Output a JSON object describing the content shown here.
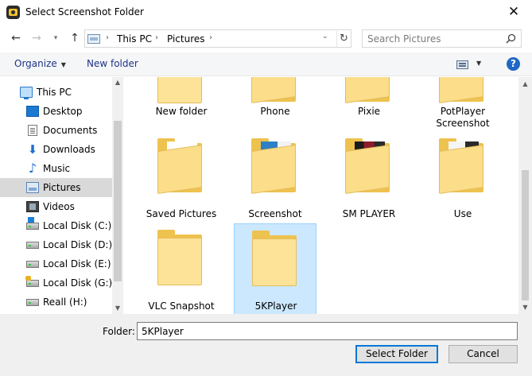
{
  "window": {
    "title": "Select Screenshot Folder",
    "close_glyph": "✕"
  },
  "navigation": {
    "back_glyph": "←",
    "forward_glyph": "→",
    "recent_glyph": "▾",
    "up_glyph": "↑",
    "breadcrumb": [
      "This PC",
      "Pictures"
    ],
    "crumb_separator": "›",
    "dropdown_glyph": "⌄",
    "refresh_glyph": "↻"
  },
  "search": {
    "placeholder": "Search Pictures"
  },
  "toolbar": {
    "organize_label": "Organize",
    "organize_caret": "▼",
    "new_folder_label": "New folder",
    "view_caret": "▼",
    "help_label": "?"
  },
  "sidebar": {
    "items": [
      {
        "label": "This PC",
        "icon": "computer-icon"
      },
      {
        "label": "Desktop",
        "icon": "desktop-folder-icon"
      },
      {
        "label": "Documents",
        "icon": "documents-icon"
      },
      {
        "label": "Downloads",
        "icon": "download-arrow-icon"
      },
      {
        "label": "Music",
        "icon": "music-note-icon"
      },
      {
        "label": "Pictures",
        "icon": "pictures-icon",
        "selected": true
      },
      {
        "label": "Videos",
        "icon": "film-icon"
      },
      {
        "label": "Local Disk (C:)",
        "icon": "system-drive-icon"
      },
      {
        "label": "Local Disk (D:)",
        "icon": "drive-icon"
      },
      {
        "label": "Local Disk (E:)",
        "icon": "drive-icon"
      },
      {
        "label": "Local Disk (G:)",
        "icon": "locked-drive-icon"
      },
      {
        "label": "Reall (H:)",
        "icon": "drive-icon"
      }
    ],
    "scroll_up_glyph": "▲",
    "scroll_down_glyph": "▼"
  },
  "content": {
    "folders": [
      {
        "label": "New folder"
      },
      {
        "label": "Phone"
      },
      {
        "label": "Pixie"
      },
      {
        "label": "PotPlayer Screenshot"
      },
      {
        "label": "Saved Pictures"
      },
      {
        "label": "Screenshot"
      },
      {
        "label": "SM PLAYER"
      },
      {
        "label": "Use"
      },
      {
        "label": "VLC Snapshot"
      },
      {
        "label": "5KPlayer",
        "selected": true
      }
    ],
    "scroll_up_glyph": "▲",
    "scroll_down_glyph": "▼"
  },
  "footer": {
    "folder_label": "Folder:",
    "folder_value": "5KPlayer",
    "select_button": "Select Folder",
    "cancel_button": "Cancel"
  },
  "colors": {
    "selection": "#cce8ff",
    "link_text": "#1e3287",
    "folder_back": "#eec24e",
    "folder_front": "#fbdd8a"
  }
}
